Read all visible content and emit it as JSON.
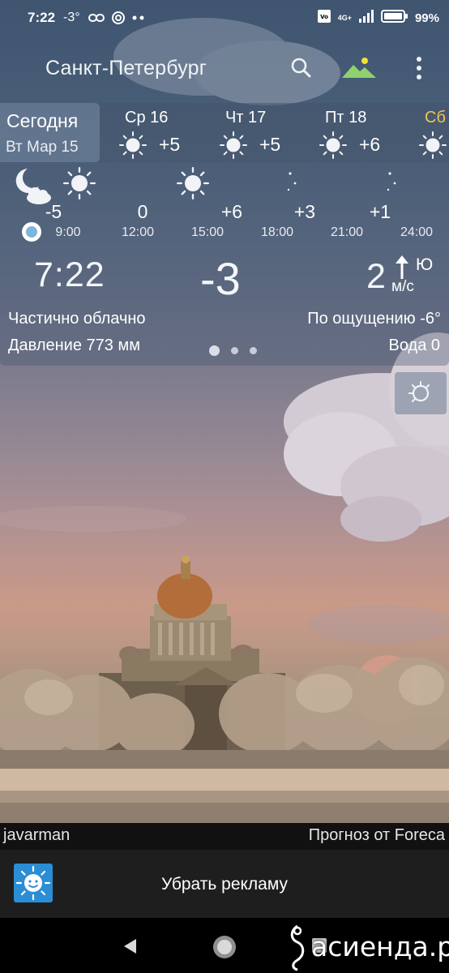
{
  "status_bar": {
    "time": "7:22",
    "temp": "-3°",
    "battery": "99%",
    "network": "4G+"
  },
  "header": {
    "city": "Санкт-Петербург",
    "icons": [
      "search-icon",
      "background-icon",
      "more-vert-icon"
    ],
    "accent_sun_color": "#f6df3c",
    "accent_hill_color": "#8fd16d"
  },
  "days": {
    "today": {
      "label": "Сегодня",
      "date": "Вт Мар 15"
    },
    "items": [
      {
        "name": "Ср 16",
        "temp": "+5",
        "icon": "sun-icon"
      },
      {
        "name": "Чт 17",
        "temp": "+5",
        "icon": "sun-icon"
      },
      {
        "name": "Пт 18",
        "temp": "+6",
        "icon": "sun-icon"
      },
      {
        "name": "Сб",
        "temp": "",
        "icon": "sun-icon"
      }
    ]
  },
  "hourly": [
    {
      "time": "9:00",
      "temp": "-5",
      "icon": "moon-cloud-icon"
    },
    {
      "time": "12:00",
      "temp": "0",
      "icon": "sun-icon"
    },
    {
      "time": "15:00",
      "temp": "+6",
      "icon": "sun-icon"
    },
    {
      "time": "18:00",
      "temp": "+3",
      "icon": "moon-stars-icon"
    },
    {
      "time": "21:00",
      "temp": "+1",
      "icon": "moon-stars-icon"
    },
    {
      "time": "24:00",
      "temp": "",
      "icon": "moon-stars-icon"
    }
  ],
  "current": {
    "time": "7:22",
    "temp": "-3",
    "wind_speed": "2",
    "wind_dir": "Ю",
    "wind_unit": "м/с",
    "description": "Частично облачно",
    "feels_like": "По ощущению -6°",
    "pressure": "Давление 773 мм",
    "water": "Вода 0",
    "page_index": 1,
    "page_count": 3
  },
  "credits": {
    "author": "javarman",
    "source": "Прогноз от Foreca"
  },
  "ad": {
    "label": "Убрать рекламу",
    "icon_color": "#2b8ed4"
  },
  "watermark": {
    "text": "асиенда.ру"
  }
}
